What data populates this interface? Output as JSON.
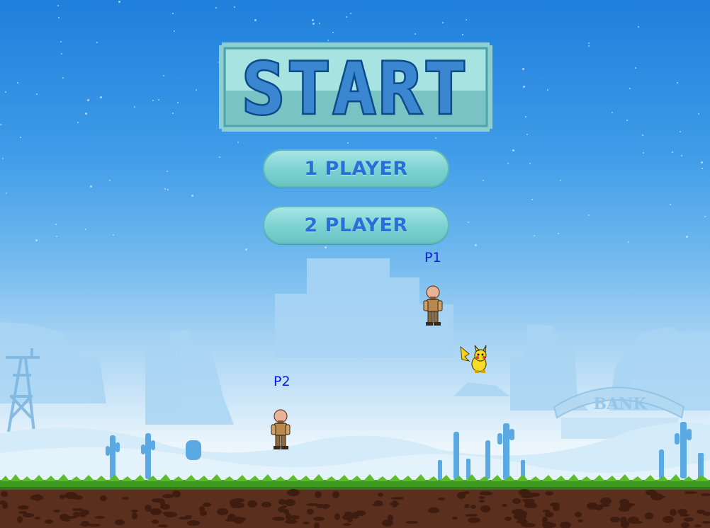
{
  "title": "START",
  "menu": {
    "one_player": "1 PLAYER",
    "two_player": "2 PLAYER"
  },
  "players": {
    "p1_label": "P1",
    "p2_label": "P2"
  },
  "sign": {
    "bank": "BANK"
  },
  "colors": {
    "sky_top": "#1f7fdc",
    "button_fill": "#86d6d6",
    "button_text": "#2a6fd8",
    "player_label": "#0a1cd8",
    "grass": "#3e9a1e",
    "dirt": "#5a2f1e"
  }
}
